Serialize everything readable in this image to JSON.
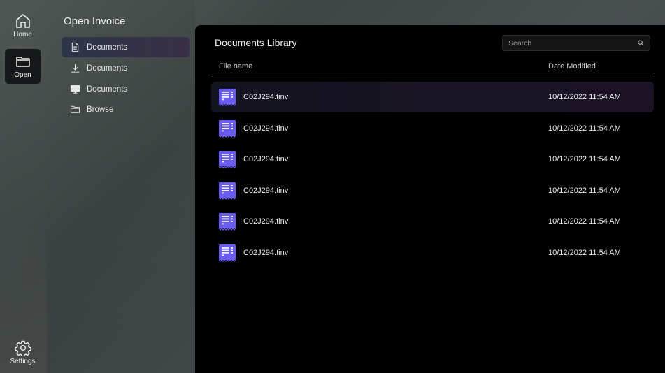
{
  "rail": {
    "home_label": "Home",
    "open_label": "Open",
    "settings_label": "Settings"
  },
  "panel": {
    "title": "Open Invoice",
    "items": [
      {
        "label": "Documents",
        "icon": "document-icon"
      },
      {
        "label": "Documents",
        "icon": "download-icon"
      },
      {
        "label": "Documents",
        "icon": "monitor-icon"
      },
      {
        "label": "Browse",
        "icon": "folder-icon"
      }
    ]
  },
  "main": {
    "title": "Documents Library",
    "search_placeholder": "Search",
    "columns": {
      "name": "File name",
      "date": "Date Modified"
    },
    "files": [
      {
        "name": "C02J294.tinv",
        "date": "10/12/2022 11:54 AM"
      },
      {
        "name": "C02J294.tinv",
        "date": "10/12/2022 11:54 AM"
      },
      {
        "name": "C02J294.tinv",
        "date": "10/12/2022 11:54 AM"
      },
      {
        "name": "C02J294.tinv",
        "date": "10/12/2022 11:54 AM"
      },
      {
        "name": "C02J294.tinv",
        "date": "10/12/2022 11:54 AM"
      },
      {
        "name": "C02J294.tinv",
        "date": "10/12/2022 11:54 AM"
      }
    ]
  },
  "colors": {
    "accent": "#5b5ef0",
    "file_icon": "#6a5cf0"
  }
}
